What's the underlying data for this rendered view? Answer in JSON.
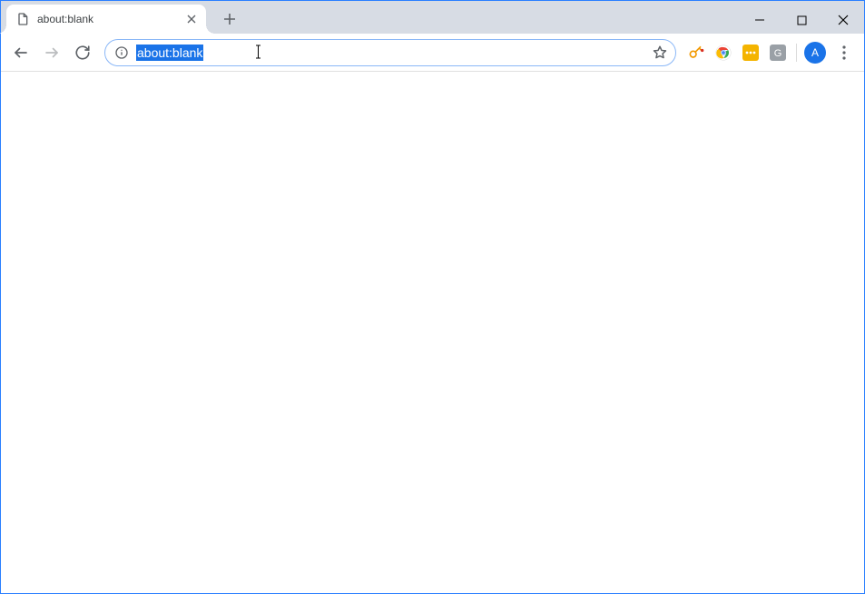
{
  "tab": {
    "title": "about:blank"
  },
  "omnibox": {
    "url": "about:blank"
  },
  "avatar": {
    "initial": "A"
  }
}
